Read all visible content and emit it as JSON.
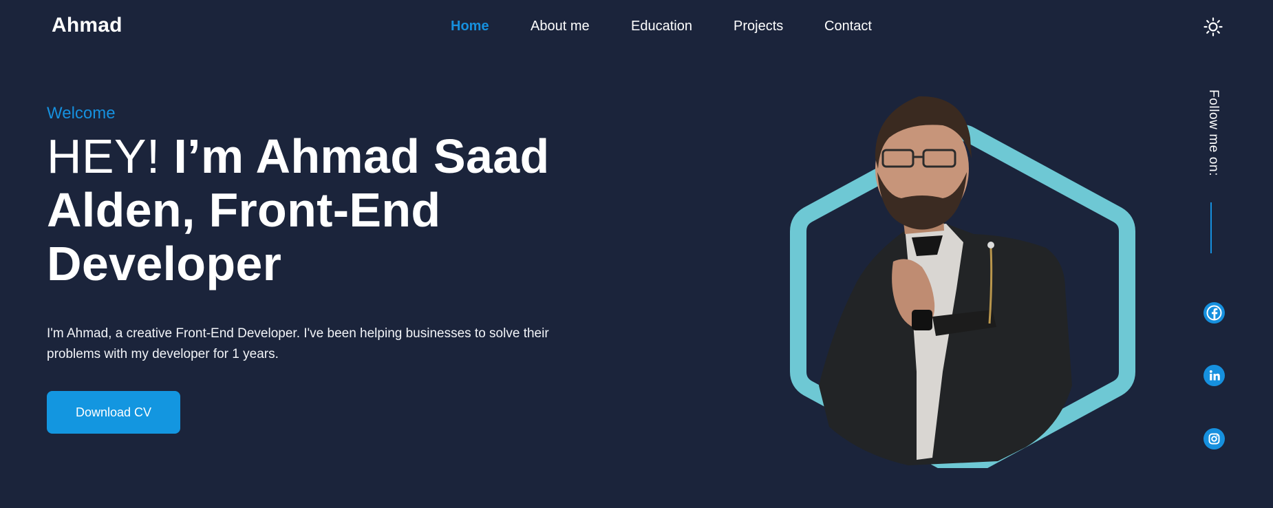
{
  "header": {
    "logo": "Ahmad",
    "nav": [
      {
        "label": "Home",
        "active": true
      },
      {
        "label": "About me",
        "active": false
      },
      {
        "label": "Education",
        "active": false
      },
      {
        "label": "Projects",
        "active": false
      },
      {
        "label": "Contact",
        "active": false
      }
    ],
    "theme_toggle_icon": "sun-icon"
  },
  "hero": {
    "welcome": "Welcome",
    "title_light": "HEY! ",
    "title_bold": "I’m Ahmad Saad Alden, Front-End Developer",
    "intro": "I'm Ahmad, a creative Front-End Developer. I've been helping businesses to solve their problems with my developer for 1 years.",
    "cv_button": "Download CV"
  },
  "social": {
    "follow_label": "Follow me on:",
    "links": [
      {
        "name": "facebook",
        "icon": "facebook-icon"
      },
      {
        "name": "linkedin",
        "icon": "linkedin-icon"
      },
      {
        "name": "instagram",
        "icon": "instagram-icon"
      }
    ]
  },
  "colors": {
    "background": "#1b243b",
    "accent": "#1690de",
    "hexagon": "#6ec8d4",
    "text": "#ffffff"
  }
}
